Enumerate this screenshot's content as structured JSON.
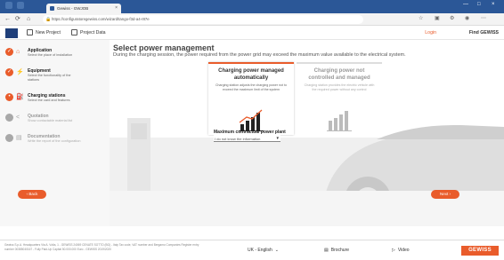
{
  "browser": {
    "tab_title": "Gewiss - GWJOB",
    "tab_close": "×",
    "url": "https://configuratoregewiss.com/wizard/tango-f3d-a4-r87e",
    "win_min": "—",
    "win_max": "□",
    "win_close": "×"
  },
  "header": {
    "new_project": "New Project",
    "project_data": "Project Data",
    "login": "Login",
    "find_gewiss": "Find GEWISS"
  },
  "steps": [
    {
      "title": "Application",
      "desc": "Select the place of installation",
      "icon": "⌂",
      "state": "done"
    },
    {
      "title": "Equipment",
      "desc": "Select the functionality of the stations",
      "icon": "⚡",
      "state": "done"
    },
    {
      "title": "Charging stations",
      "desc": "Select the card and features",
      "icon": "⛽",
      "state": "current"
    },
    {
      "title": "Quotation",
      "desc": "Show contactable material list",
      "icon": "<",
      "state": "todo"
    },
    {
      "title": "Documentation",
      "desc": "Write the report of the configuration",
      "icon": "▤",
      "state": "todo"
    }
  ],
  "main": {
    "title": "Select power management",
    "subtitle": "During the charging session, the power required from the power grid may exceed the maximum value available to the electrical system.",
    "cards": [
      {
        "title": "Charging power managed automatically",
        "desc": "Charging station adjusts the charging power not to exceed the maximum limit of the system",
        "selected": true
      },
      {
        "title": "Charging power not controlled and managed",
        "desc": "Charging station provides the electric vehicle with the required power without any control",
        "selected": false
      }
    ],
    "power_label": "Maximum contractual power plant",
    "power_value": "I do not know the information"
  },
  "buttons": {
    "back": "‹ Back",
    "next": "Next ›"
  },
  "footer": {
    "legal": "Gewiss S.p.A. Headquarters Via A. Volta, 1 - GEWISS 24069 CENATE SOTTO (BG) - Italy Tax code, VAT number and Bergamo Companies Register entry number 00385040167 - Fully Paid-Up Capital 50.000.000 Euro - GEWISS 2019/2020",
    "language": "UK - English",
    "brochure": "Brochure",
    "video": "Video",
    "logo": "GEWISS"
  },
  "colors": {
    "accent": "#e95c2b",
    "chrome": "#2b5797",
    "done": "#e95c2b",
    "todo": "#a8a8a8"
  }
}
